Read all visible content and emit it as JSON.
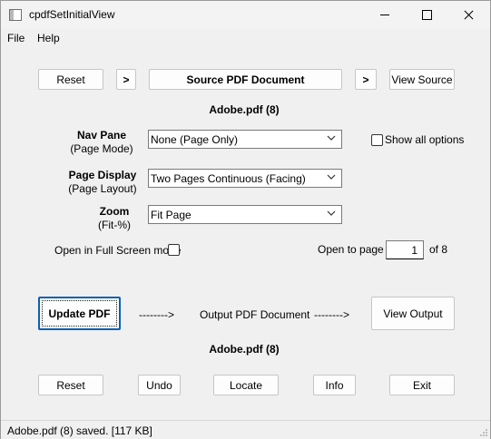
{
  "window": {
    "title": "cpdfSetInitialView"
  },
  "menu": {
    "file": "File",
    "help": "Help"
  },
  "top": {
    "reset": "Reset",
    "arrow_left": ">",
    "source": "Source PDF Document",
    "arrow_right": ">",
    "view_source": "View Source"
  },
  "source_file": "Adobe.pdf (8)",
  "nav_pane": {
    "title": "Nav Pane",
    "subtitle": "(Page Mode)",
    "value": "None (Page Only)"
  },
  "page_display": {
    "title": "Page Display",
    "subtitle": "(Page Layout)",
    "value": "Two Pages Continuous (Facing)"
  },
  "zoom": {
    "title": "Zoom",
    "subtitle": "(Fit-%)",
    "value": "Fit Page"
  },
  "show_all_options": "Show all options",
  "full_screen": "Open in Full Screen mode",
  "open_to_page": {
    "label": "Open to page",
    "value": "1",
    "of": "of 8"
  },
  "update_pdf": "Update PDF",
  "arrow_a": "-------->",
  "output_label": "Output PDF Document",
  "arrow_b": "-------->",
  "view_output": "View Output",
  "output_file": "Adobe.pdf (8)",
  "bottom": {
    "reset": "Reset",
    "undo": "Undo",
    "locate": "Locate",
    "info": "Info",
    "exit": "Exit"
  },
  "status": "Adobe.pdf (8) saved.  [117 KB]",
  "icons": [
    "app-icon",
    "minimize-icon",
    "maximize-icon",
    "close-icon",
    "chevron-down-icon",
    "resize-grip-icon"
  ]
}
